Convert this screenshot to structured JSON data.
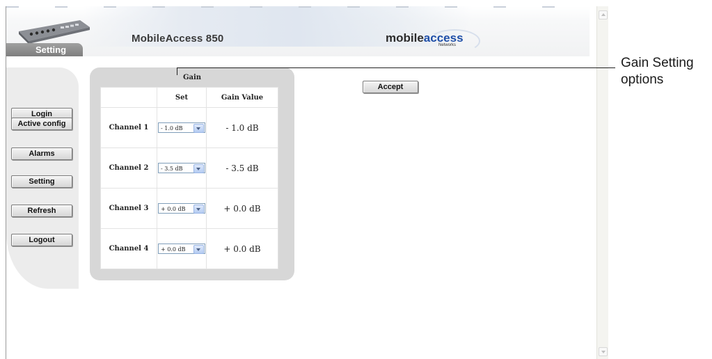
{
  "header": {
    "title": "MobileAccess 850",
    "tab_label": "Setting",
    "logo_mobile": "mobile",
    "logo_access": "access",
    "logo_networks": "Networks"
  },
  "menu": {
    "items": [
      {
        "label": "Login"
      },
      {
        "label": "Active config"
      },
      {
        "label": "Alarms"
      },
      {
        "label": "Setting"
      },
      {
        "label": "Refresh"
      },
      {
        "label": "Logout"
      }
    ]
  },
  "gain": {
    "title": "Gain",
    "col_set": "Set",
    "col_value": "Gain Value",
    "channels": [
      {
        "label": "Channel 1",
        "set": "- 1.0 dB",
        "value": "- 1.0 dB"
      },
      {
        "label": "Channel 2",
        "set": "- 3.5 dB",
        "value": "- 3.5 dB"
      },
      {
        "label": "Channel 3",
        "set": "+ 0.0 dB",
        "value": "+ 0.0 dB"
      },
      {
        "label": "Channel 4",
        "set": "+ 0.0 dB",
        "value": "+ 0.0 dB"
      }
    ]
  },
  "accept_label": "Accept",
  "callout": {
    "text": "Gain Setting options"
  },
  "colors": {
    "logo_access": "#1f4fa8",
    "panel_gray": "#d7d7d7",
    "menu_panel": "#ececec"
  }
}
